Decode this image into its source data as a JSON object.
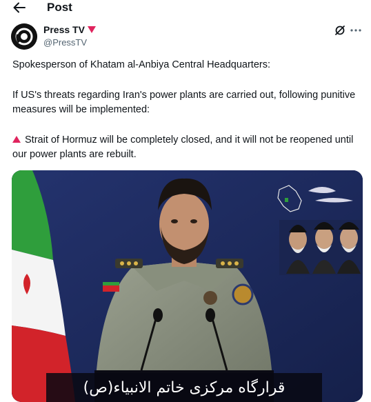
{
  "header": {
    "title": "Post"
  },
  "author": {
    "name": "Press TV",
    "handle": "@PressTV"
  },
  "tweet": {
    "line1": "Spokesperson of Khatam al-Anbiya Central Headquarters:",
    "line2": "If US's threats regarding Iran's power plants are carried out, following punitive measures will be implemented:",
    "line3": "Strait of Hormuz will be completely closed, and it will not be reopened until our power plants are rebuilt."
  },
  "media": {
    "caption": "قرارگاه مرکزی خاتم الانبیاء(ص)"
  },
  "icons": {
    "back": "arrow-left-icon",
    "grok": "grok-icon",
    "more": "more-dots-icon",
    "badge": "red-triangle-badge-icon",
    "bullet": "red-triangle-icon"
  },
  "colors": {
    "accent_red": "#e0245e",
    "handle_gray": "#536471",
    "backdrop_blue": "#1c2a5c"
  }
}
